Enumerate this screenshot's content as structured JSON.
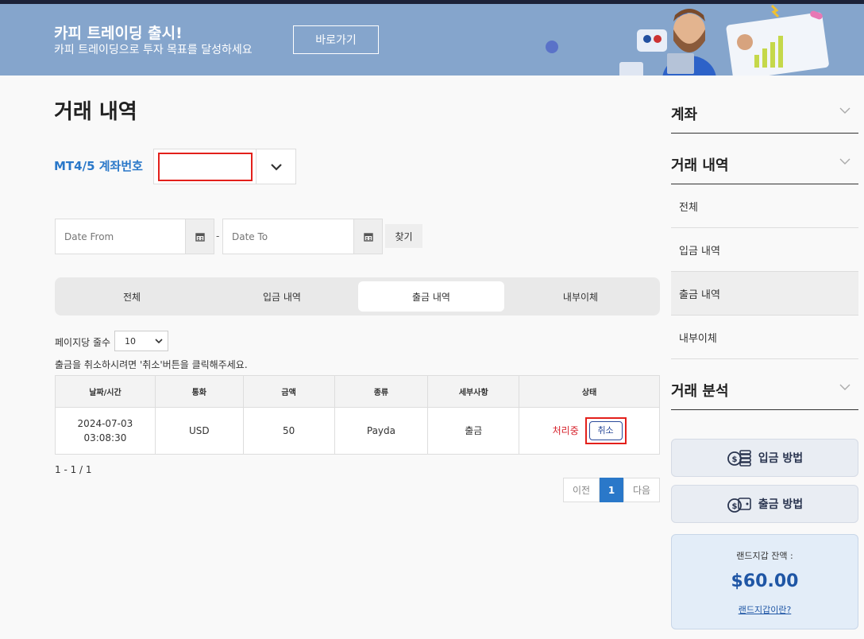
{
  "banner": {
    "title": "카피 트레이딩 출시!",
    "subtitle": "카피 트레이딩으로 투자 목표를 달성하세요",
    "button_label": "바로가기"
  },
  "page": {
    "title": "거래 내역"
  },
  "account": {
    "label": "MT4/5 계좌번호",
    "value": ""
  },
  "filter": {
    "date_from_placeholder": "Date From",
    "date_to_placeholder": "Date To",
    "separator": "-",
    "search_label": "찾기"
  },
  "tabs": [
    {
      "label": "전체"
    },
    {
      "label": "입금 내역"
    },
    {
      "label": "출금 내역",
      "active": true
    },
    {
      "label": "내부이체"
    }
  ],
  "list": {
    "per_page_label": "페이지당 줄수",
    "per_page_value": "10",
    "notice": "출금을 취소하시려면 '취소'버튼을 클릭해주세요."
  },
  "table": {
    "headers": [
      "날짜/시간",
      "통화",
      "금액",
      "종류",
      "세부사항",
      "상태"
    ],
    "rows": [
      {
        "date": "2024-07-03",
        "time": "03:08:30",
        "currency": "USD",
        "amount": "50",
        "type": "Payda",
        "detail": "출금",
        "status": "처리중",
        "action": "취소"
      }
    ]
  },
  "pagination": {
    "range": "1 - 1 / 1",
    "prev": "이전",
    "current": "1",
    "next": "다음"
  },
  "sidebar": {
    "section_account": "계좌",
    "section_history": "거래 내역",
    "items": [
      {
        "label": "전체"
      },
      {
        "label": "입금 내역"
      },
      {
        "label": "출금 내역",
        "active": true
      },
      {
        "label": "내부이체"
      }
    ],
    "section_analysis": "거래 분석",
    "deposit_method": "입금 방법",
    "withdraw_method": "출금 방법"
  },
  "wallet": {
    "label": "랜드지갑 잔액 :",
    "amount": "$60.00",
    "link": "랜드지갑이란?"
  },
  "colors": {
    "banner_bg": "#85a5cc",
    "accent_blue": "#2a78c9",
    "status_red": "#d6202a",
    "highlight_red": "#e3201b"
  }
}
